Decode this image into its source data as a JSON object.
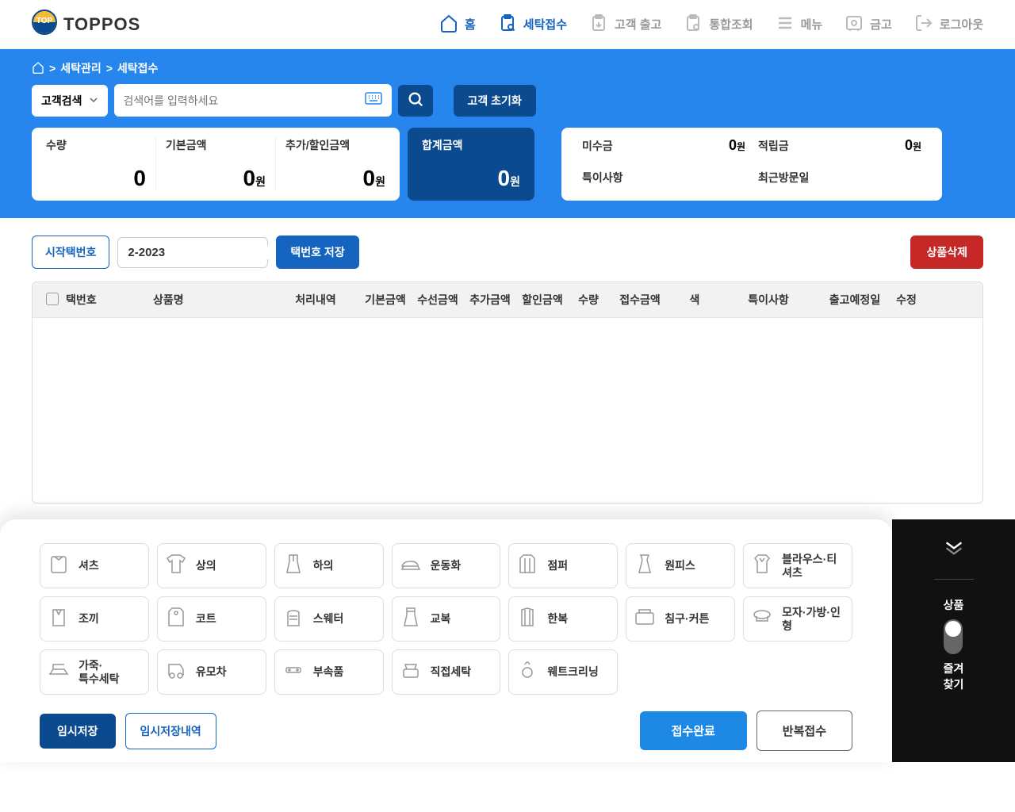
{
  "brand": "TOPPOS",
  "nav": {
    "home": "홈",
    "receive": "세탁접수",
    "checkout": "고객 출고",
    "unified": "통합조회",
    "menu": "메뉴",
    "cash": "금고",
    "logout": "로그아웃"
  },
  "breadcrumb": {
    "a": "세탁관리",
    "b": "세탁접수"
  },
  "search": {
    "mode": "고객검색",
    "placeholder": "검색어를 입력하세요",
    "reset": "고객 초기화"
  },
  "summary": {
    "qty_label": "수량",
    "qty": "0",
    "base_label": "기본금액",
    "base": "0",
    "unit": "원",
    "extra_label": "추가/할인금액",
    "extra": "0",
    "total_label": "합계금액",
    "total": "0",
    "due_label": "미수금",
    "due": "0",
    "point_label": "적립금",
    "point": "0",
    "note_label": "특이사항",
    "last_label": "최근방문일"
  },
  "tag": {
    "start_btn": "시작택번호",
    "value": "2-2023",
    "save_btn": "택번호 저장",
    "delete_btn": "상품삭제"
  },
  "columns": {
    "tagno": "택번호",
    "name": "상품명",
    "proc": "처리내역",
    "base": "기본금액",
    "repair": "수선금액",
    "extra": "추가금액",
    "disc": "할인금액",
    "qty": "수량",
    "recv": "접수금액",
    "color": "색",
    "note": "특이사항",
    "date": "출고예정일",
    "edit": "수정"
  },
  "categories": [
    "셔츠",
    "상의",
    "하의",
    "운동화",
    "점퍼",
    "원피스",
    "블라우스·티셔츠",
    "조끼",
    "코트",
    "스웨터",
    "교복",
    "한복",
    "침구·커튼",
    "모자·가방·인형",
    "가죽·<br>특수세탁",
    "유모차",
    "부속품",
    "직접세탁",
    "웨트크리닝"
  ],
  "actions": {
    "temp_save": "임시저장",
    "temp_history": "임시저장내역",
    "confirm": "접수완료",
    "repeat": "반복접수"
  },
  "dock": {
    "top": "상품",
    "bottom": "즐겨<br>찾기"
  }
}
